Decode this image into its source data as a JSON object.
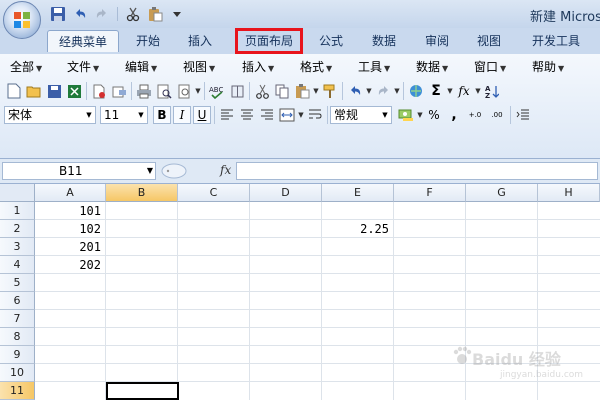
{
  "window": {
    "title": "新建 Micros"
  },
  "ribbon_tabs": [
    "经典菜单",
    "开始",
    "插入",
    "页面布局",
    "公式",
    "数据",
    "审阅",
    "视图",
    "开发工具"
  ],
  "menu": [
    "全部",
    "文件",
    "编辑",
    "视图",
    "插入",
    "格式",
    "工具",
    "数据",
    "窗口",
    "帮助"
  ],
  "font": {
    "name": "宋体",
    "size": "11"
  },
  "format": {
    "bold": "B",
    "italic": "I",
    "underline": "U",
    "number_format": "常规",
    "percent": "%",
    "comma": ",",
    "inc_decimal": "+.0",
    "dec_decimal": ".00"
  },
  "toolbar": {
    "sum": "Σ",
    "function": "fx"
  },
  "formula_bar": {
    "name_box": "B11",
    "fx": "fx",
    "value": ""
  },
  "columns": [
    "A",
    "B",
    "C",
    "D",
    "E",
    "F",
    "G",
    "H"
  ],
  "rows": [
    "1",
    "2",
    "3",
    "4",
    "5",
    "6",
    "7",
    "8",
    "9",
    "10",
    "11"
  ],
  "cells": {
    "A1": "101",
    "A2": "102",
    "A3": "201",
    "A4": "202",
    "E2": "2.25"
  },
  "selected": {
    "column": "B",
    "row": "11"
  },
  "watermark": {
    "text": "Baidu 经验",
    "sub": "jingyan.baidu.com"
  },
  "colors": {
    "highlight": "#e8141c",
    "selection": "#f6c766"
  }
}
